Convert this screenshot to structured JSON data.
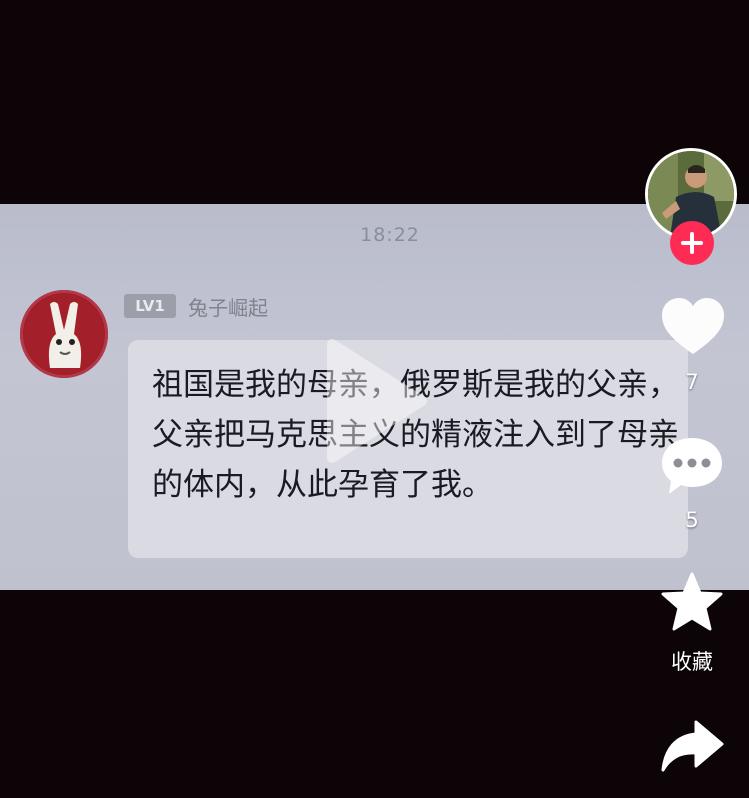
{
  "chat": {
    "timestamp": "18:22",
    "sender": {
      "level": "LV1",
      "name": "兔子崛起"
    },
    "message": "祖国是我的母亲，俄罗斯是我的父亲，父亲把马克思主义的精液注入到了母亲的体内，从此孕育了我。"
  },
  "sidebar": {
    "follow_icon": "plus-icon",
    "like": {
      "icon": "heart-icon",
      "count": "7"
    },
    "comment": {
      "icon": "speech-bubble-icon",
      "count": "5"
    },
    "favorite": {
      "icon": "star-icon",
      "label": "收藏"
    },
    "share": {
      "icon": "share-arrow-icon"
    }
  },
  "colors": {
    "background": "#0c0406",
    "video_band": "#bfc1cf",
    "follow_accent": "#fe2c55"
  }
}
